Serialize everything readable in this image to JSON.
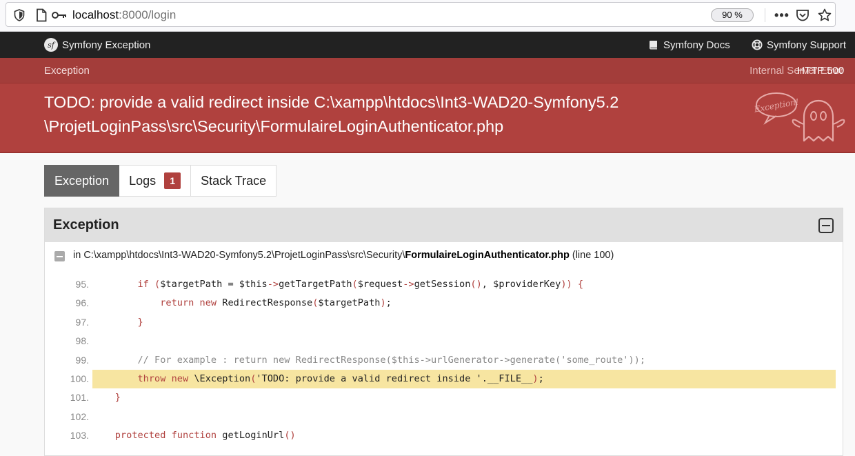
{
  "browser": {
    "url_host": "localhost",
    "url_rest": ":8000/login",
    "zoom": "90 %"
  },
  "topbar": {
    "brand": "Symfony Exception",
    "docs": "Symfony Docs",
    "support": "Symfony Support"
  },
  "header": {
    "label": "Exception",
    "http_code": "HTTP 500",
    "http_reason": "Internal Server Error",
    "message_line1": "TODO: provide a valid redirect inside C:\\xampp\\htdocs\\Int3-WAD20-Symfony5.2",
    "message_line2": "\\ProjetLoginPass\\src\\Security\\FormulaireLoginAuthenticator.php",
    "ghost_label": "Exception!"
  },
  "tabs": [
    {
      "label": "Exception",
      "active": true
    },
    {
      "label": "Logs",
      "badge": "1"
    },
    {
      "label": "Stack Trace"
    }
  ],
  "panel": {
    "title": "Exception",
    "trace_prefix": "in C:\\xampp\\htdocs\\Int3-WAD20-Symfony5.2\\ProjetLoginPass\\src\\Security\\",
    "trace_file": "FormulaireLoginAuthenticator.php",
    "trace_suffix": " (line 100)"
  },
  "code_lines": [
    {
      "n": "95.",
      "text": "        if ($targetPath = $this->getTargetPath($request->getSession(), $providerKey)) {"
    },
    {
      "n": "96.",
      "text": "            return new RedirectResponse($targetPath);"
    },
    {
      "n": "97.",
      "text": "        }"
    },
    {
      "n": "98.",
      "text": ""
    },
    {
      "n": "99.",
      "text": "        // For example : return new RedirectResponse($this->urlGenerator->generate('some_route'));"
    },
    {
      "n": "100.",
      "text": "        throw new \\Exception('TODO: provide a valid redirect inside '.__FILE__);",
      "highlight": true
    },
    {
      "n": "101.",
      "text": "    }"
    },
    {
      "n": "102.",
      "text": ""
    },
    {
      "n": "103.",
      "text": "    protected function getLoginUrl()"
    }
  ],
  "colors": {
    "header_red": "#b0413e",
    "topbar": "#222222",
    "highlight": "#f7e5a1"
  }
}
